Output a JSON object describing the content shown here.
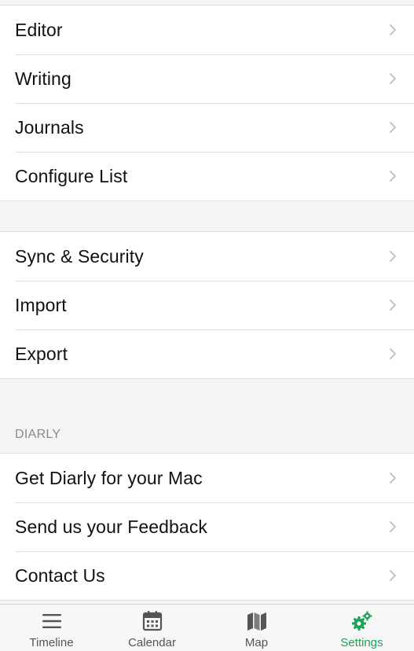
{
  "groups": [
    {
      "items": [
        {
          "label": "Editor"
        },
        {
          "label": "Writing"
        },
        {
          "label": "Journals"
        },
        {
          "label": "Configure List"
        }
      ]
    },
    {
      "items": [
        {
          "label": "Sync & Security"
        },
        {
          "label": "Import"
        },
        {
          "label": "Export"
        }
      ]
    },
    {
      "header": "DIARLY",
      "items": [
        {
          "label": "Get Diarly for your Mac"
        },
        {
          "label": "Send us your Feedback"
        },
        {
          "label": "Contact Us"
        }
      ]
    }
  ],
  "tabbar": {
    "tabs": [
      {
        "label": "Timeline",
        "icon": "hamburger-icon"
      },
      {
        "label": "Calendar",
        "icon": "calendar-icon"
      },
      {
        "label": "Map",
        "icon": "map-icon"
      },
      {
        "label": "Settings",
        "icon": "gears-icon"
      }
    ],
    "active_index": 3
  },
  "colors": {
    "accent": "#1aa35a",
    "background": "#f4f4f4",
    "separator": "#e0e0e0",
    "chevron": "#c4c4c8",
    "tab_inactive": "#555555"
  }
}
